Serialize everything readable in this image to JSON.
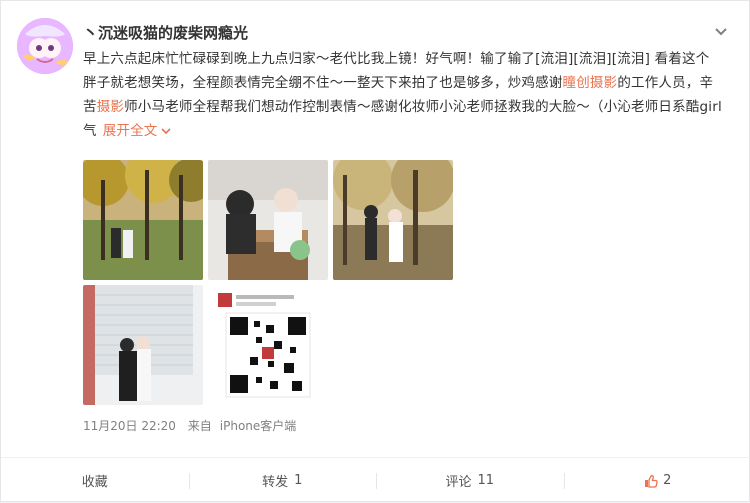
{
  "post": {
    "username": "丶沉迷吸猫的废柴网瘾光",
    "content": {
      "part1": "早上六点起床忙忙碌碌到晚上九点归家～老代比我上镜！好气啊！输了输了[流泪][流泪][流泪] 看着这个胖子就老想笑场，全程颜表情完全绷不住～一整天下来拍了也是够多，炒鸡感谢",
      "link1": "瞳创摄影",
      "part2": "的工作人员，辛苦",
      "link2": "摄影",
      "part3": "师小马老师全程帮我们想动作控制表情～感谢化妆师小沁老师拯救我的大脸～（小沁老师日系酷girl气",
      "expand": "展开全文"
    },
    "thumbnail_qr_caption": "A婚纱小姐姐·瞳摄影123..."
  },
  "meta": {
    "date": "11月20日 22:20",
    "from": "来自",
    "client": "iPhone客户端"
  },
  "actions": {
    "collect": "收藏",
    "repost_label": "转发",
    "repost_count": "1",
    "comment_label": "评论",
    "comment_count": "11",
    "like_count": "2"
  },
  "colors": {
    "accent": "#eb7350",
    "text": "#333333",
    "meta": "#808080"
  },
  "icons": {
    "more": "chevron-down-icon",
    "like": "thumbs-up-icon"
  }
}
